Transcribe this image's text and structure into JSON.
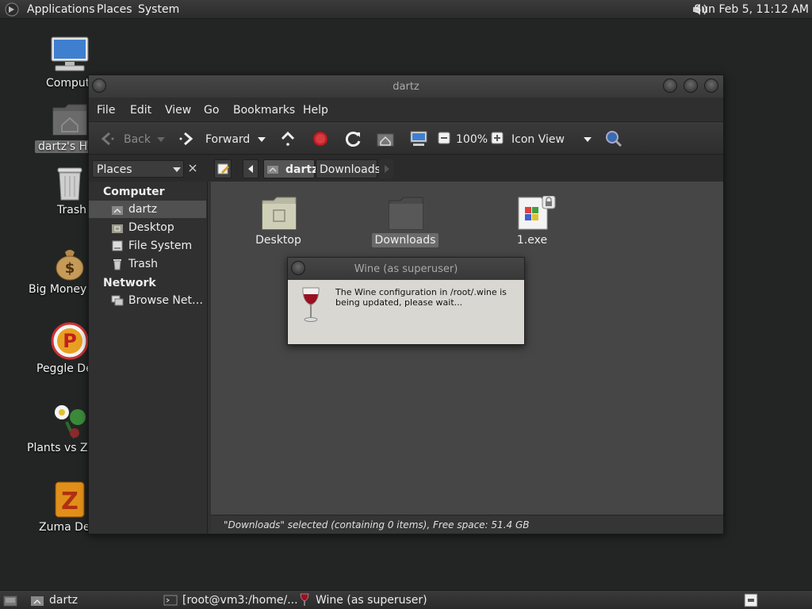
{
  "top_panel": {
    "menus": [
      "Applications",
      "Places",
      "System"
    ],
    "clock": "Sun Feb  5, 11:12 AM"
  },
  "desktop_icons": [
    {
      "label": "Compute",
      "icon": "computer-icon"
    },
    {
      "label": "dartz's Ho",
      "icon": "home-folder-icon"
    },
    {
      "label": "Trash",
      "icon": "trash-icon"
    },
    {
      "label": "Big Money D",
      "icon": "money-bag-icon"
    },
    {
      "label": "Peggle Del",
      "icon": "peggle-icon"
    },
    {
      "label": "Plants vs Zon",
      "icon": "plants-icon"
    },
    {
      "label": "Zuma Delu",
      "icon": "zuma-icon"
    }
  ],
  "window": {
    "title": "dartz",
    "menu": [
      "File",
      "Edit",
      "View",
      "Go",
      "Bookmarks",
      "Help"
    ],
    "toolbar": {
      "back": "Back",
      "forward": "Forward",
      "zoom": "100%",
      "view_mode": "Icon View"
    },
    "sidebar_selector": "Places",
    "breadcrumbs": [
      "dartz",
      "Downloads"
    ],
    "sidebar": {
      "computer_heading": "Computer",
      "computer_items": [
        "dartz",
        "Desktop",
        "File System",
        "Trash"
      ],
      "network_heading": "Network",
      "network_items": [
        "Browse Net…"
      ]
    },
    "files": [
      {
        "name": "Desktop",
        "icon": "folder-icon"
      },
      {
        "name": "Downloads",
        "icon": "folder-icon",
        "selected": true
      },
      {
        "name": "1.exe",
        "icon": "exe-file-icon"
      }
    ],
    "status": "\"Downloads\" selected (containing 0 items), Free space: 51.4 GB"
  },
  "dialog": {
    "title": "Wine (as superuser)",
    "message": "The Wine configuration in /root/.wine is being updated, please wait..."
  },
  "bottom_panel": {
    "tasks": [
      "dartz",
      "[root@vm3:/home/...",
      "Wine (as superuser)"
    ]
  },
  "colors": {
    "desktop": "#232524",
    "window_bg": "#323232",
    "content_bg": "#464646",
    "dialog_bg": "#d9d7d1",
    "stop_red": "#c0222a"
  }
}
